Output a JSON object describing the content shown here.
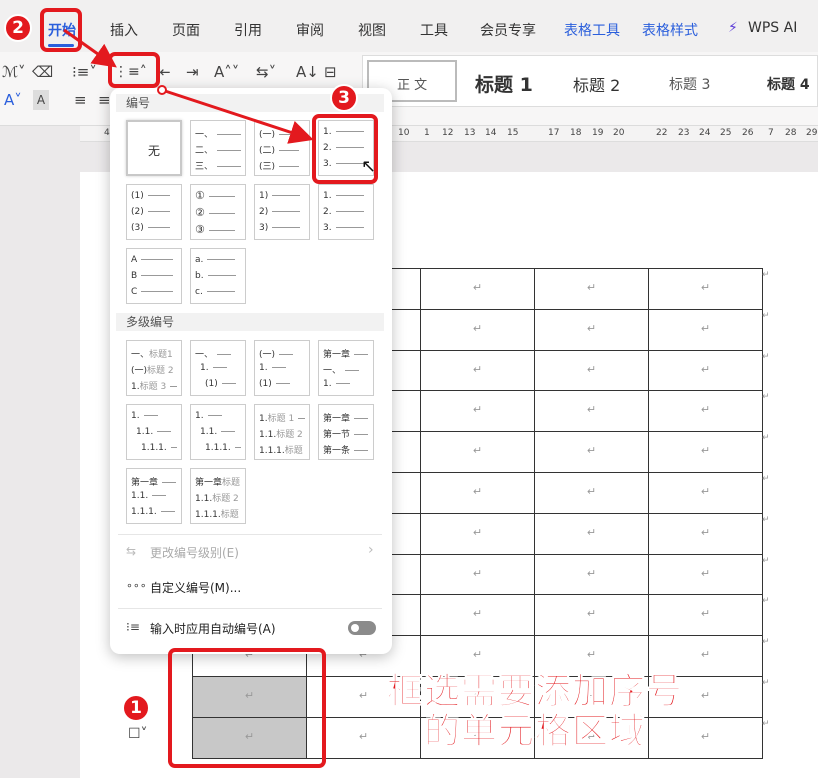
{
  "tabs": {
    "items": [
      {
        "label": "开始"
      },
      {
        "label": "插入"
      },
      {
        "label": "页面"
      },
      {
        "label": "引用"
      },
      {
        "label": "审阅"
      },
      {
        "label": "视图"
      },
      {
        "label": "工具"
      },
      {
        "label": "会员专享"
      },
      {
        "label": "表格工具"
      },
      {
        "label": "表格样式"
      },
      {
        "label": "WPS AI"
      }
    ]
  },
  "styles": {
    "items": [
      {
        "label": "正 文"
      },
      {
        "label": "标题 1"
      },
      {
        "label": "标题 2"
      },
      {
        "label": "标题 3"
      },
      {
        "label": "标题 4"
      }
    ]
  },
  "ruler": {
    "ticks": [
      "4",
      "10",
      "1",
      "12",
      "13",
      "14",
      "15",
      "17",
      "18",
      "19",
      "20",
      "22",
      "23",
      "24",
      "25",
      "26",
      "7",
      "28",
      "29"
    ]
  },
  "menu": {
    "numbering_title": "编号",
    "none_label": "无",
    "multilevel_title": "多级编号",
    "items": {
      "change_level": "更改编号级别(E)",
      "custom": "自定义编号(M)...",
      "auto_number": "输入时应用自动编号(A)"
    },
    "cards": {
      "chinese_dun": [
        "一、",
        "二、",
        "三、"
      ],
      "chinese_paren": [
        "(一)",
        "(二)",
        "(三)"
      ],
      "decimal_dot": [
        "1.",
        "2.",
        "3."
      ],
      "paren_arabic": [
        "(1)",
        "(2)",
        "(3)"
      ],
      "circled": [
        "①",
        "②",
        "③"
      ],
      "arabic_paren": [
        "1)",
        "2)",
        "3)"
      ],
      "decimal_dot_2": [
        "1.",
        "2.",
        "3."
      ],
      "upper_alpha": [
        "A",
        "B",
        "C"
      ],
      "lower_alpha": [
        "a.",
        "b.",
        "c."
      ]
    },
    "multilevel": {
      "m1": [
        [
          "一、",
          "标题1"
        ],
        [
          "(一)",
          "标题 2"
        ],
        [
          "1.",
          "标题 3"
        ]
      ],
      "m2": [
        [
          "一、",
          ""
        ],
        [
          "1.",
          ""
        ],
        [
          "(1)",
          ""
        ]
      ],
      "m3": [
        [
          "(一)",
          ""
        ],
        [
          "1.",
          ""
        ],
        [
          "(1)",
          ""
        ]
      ],
      "m4": [
        [
          "第一章",
          ""
        ],
        [
          "一、",
          ""
        ],
        [
          "1.",
          ""
        ]
      ],
      "m5": [
        [
          "1.",
          ""
        ],
        [
          "1.1.",
          ""
        ],
        [
          "1.1.1.",
          ""
        ]
      ],
      "m6": [
        [
          "1.",
          ""
        ],
        [
          "1.1.",
          ""
        ],
        [
          "1.1.1.",
          ""
        ]
      ],
      "m7": [
        [
          "1.",
          "标题 1"
        ],
        [
          "1.1.",
          "标题 2"
        ],
        [
          "1.1.1.",
          "标题 3"
        ]
      ],
      "m8": [
        [
          "第一章",
          ""
        ],
        [
          "第一节",
          ""
        ],
        [
          "第一条",
          ""
        ]
      ],
      "m9": [
        [
          "第一章",
          ""
        ],
        [
          "1.1.",
          ""
        ],
        [
          "1.1.1.",
          ""
        ]
      ],
      "m10": [
        [
          "第一章",
          "标题1"
        ],
        [
          "1.1.",
          "标题 2"
        ],
        [
          "1.1.1.",
          "标题 3"
        ]
      ]
    }
  },
  "table": {
    "cell_mark": "↵"
  },
  "annotations": {
    "badge_1": "1",
    "badge_2": "2",
    "badge_3": "3",
    "caption_line1": "框选需要添加序号",
    "caption_line2": "的单元格区域",
    "highlight_color": "#e3191e"
  },
  "colors": {
    "accent": "#2b5fdc",
    "annotation_red": "#e3191e"
  }
}
